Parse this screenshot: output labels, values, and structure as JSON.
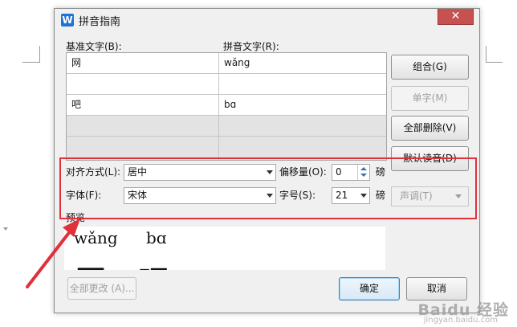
{
  "dialog": {
    "title": "拼音指南",
    "icon": "wps-writer-icon",
    "close_symbol": "✕"
  },
  "table": {
    "base_header": "基准文字(B):",
    "pinyin_header": "拼音文字(R):",
    "rows": [
      {
        "base": "网",
        "pinyin": "wǎng"
      },
      {
        "base": "",
        "pinyin": ""
      },
      {
        "base": "吧",
        "pinyin": "bɑ"
      },
      {
        "base": "",
        "pinyin": ""
      },
      {
        "base": "",
        "pinyin": ""
      }
    ]
  },
  "buttons": {
    "group": "组合(G)",
    "single": "单字(M)",
    "delete_all": "全部删除(V)",
    "default_reading": "默认读音(D)",
    "change_all": "全部更改 (A)...",
    "ok": "确定",
    "cancel": "取消"
  },
  "options": {
    "align_label": "对齐方式(L):",
    "align_value": "居中",
    "offset_label": "偏移量(O):",
    "offset_value": "0",
    "offset_unit": "磅",
    "font_label": "字体(F):",
    "font_value": "宋体",
    "size_label": "字号(S):",
    "size_value": "21",
    "size_unit": "磅",
    "tone_value": "声调(T)"
  },
  "preview": {
    "label": "预览",
    "pinyin_1": "wǎng",
    "pinyin_2": "bɑ",
    "char_1": "网",
    "char_2": "吧"
  },
  "watermark": {
    "brand": "Baidu 经验",
    "site": "jingyan.baidu.com"
  },
  "colors": {
    "highlight": "#e0313b",
    "arrow": "#e0313b",
    "close_button": "#c75050",
    "primary_button_border": "#3c7fb1"
  }
}
